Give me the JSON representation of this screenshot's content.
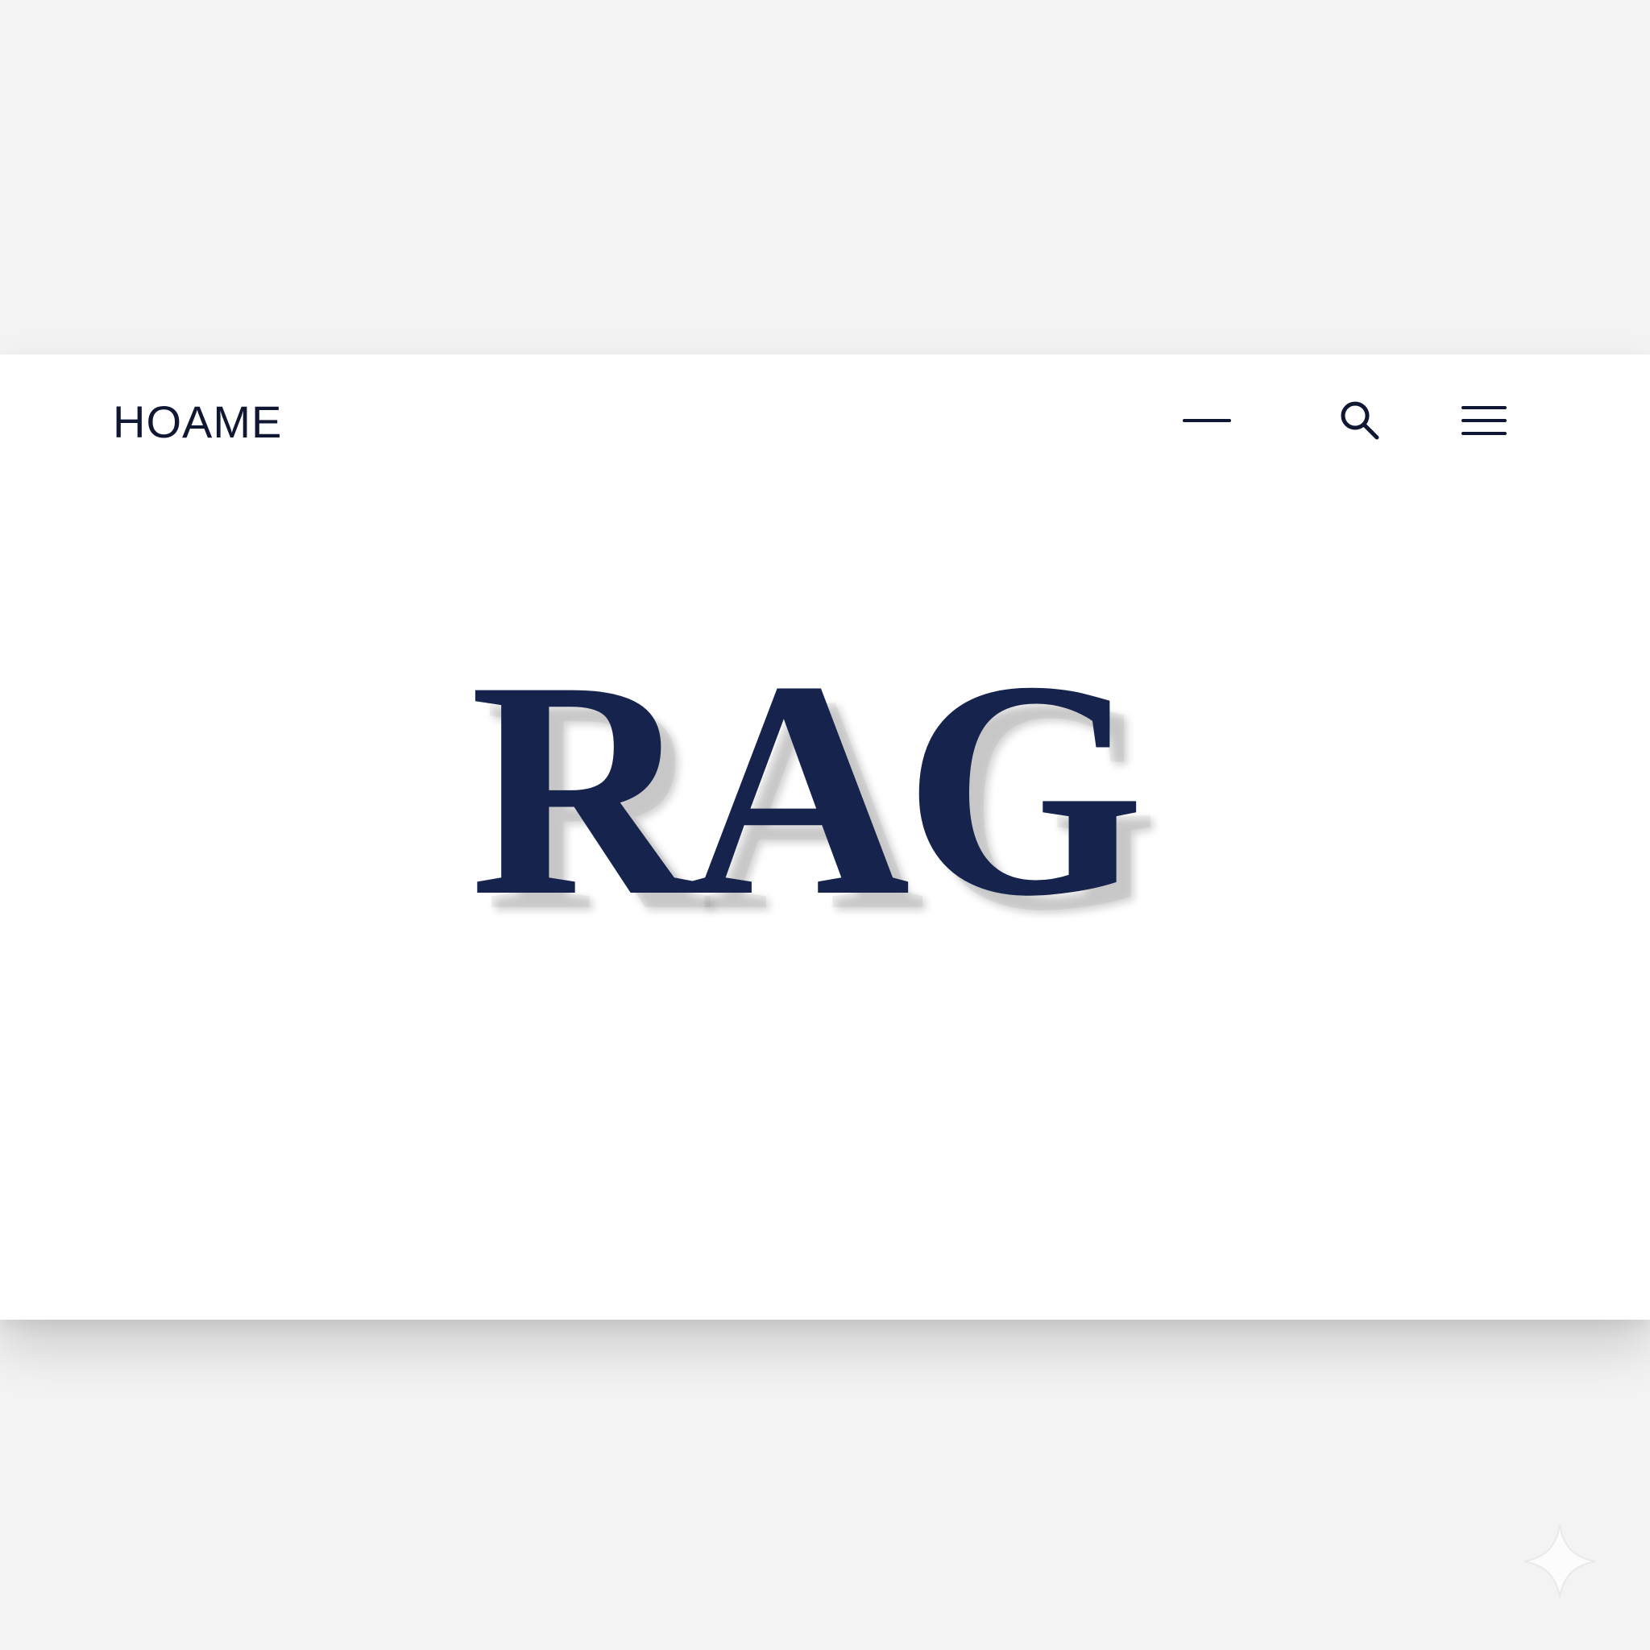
{
  "header": {
    "brand": "HOAME"
  },
  "hero": {
    "title": "RAG"
  },
  "actions": {
    "minimize_icon": "minus-icon",
    "search_icon": "search-icon",
    "menu_icon": "menu-icon"
  },
  "decor": {
    "sparkle_icon": "sparkle-icon"
  },
  "colors": {
    "background": "#f3f3f3",
    "card": "#ffffff",
    "ink": "#0f1732",
    "hero": "#16244d"
  }
}
